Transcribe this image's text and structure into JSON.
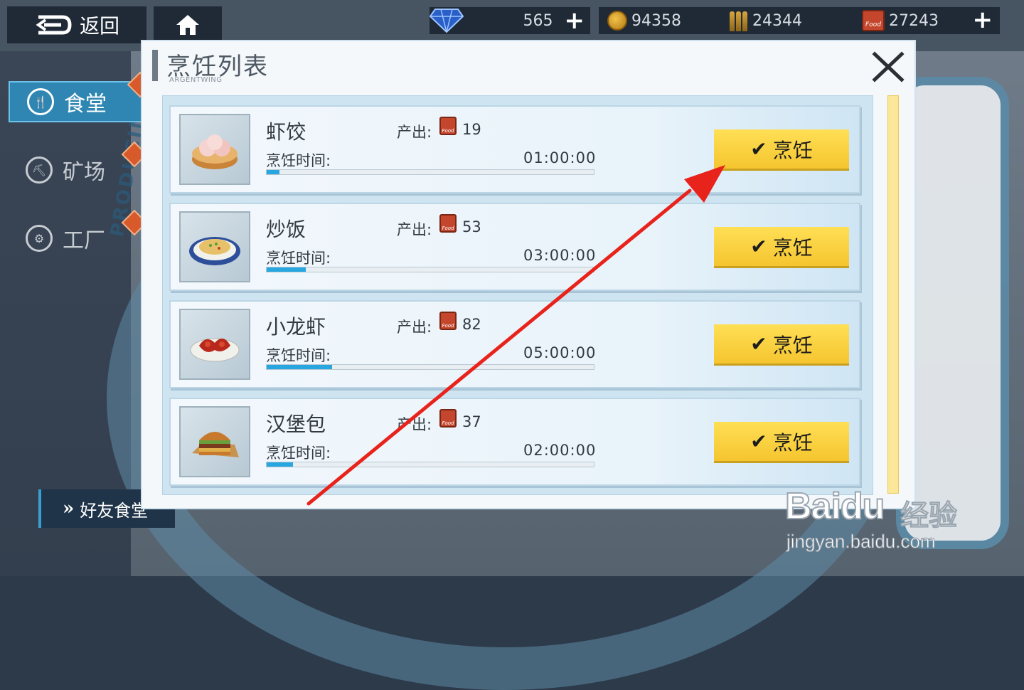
{
  "topbar": {
    "back_label": "返回",
    "diamonds": "565",
    "coins": "94358",
    "ammo": "24344",
    "food": "27243",
    "food_icon_text": "Food"
  },
  "sidebar": {
    "items": [
      {
        "label": "食堂",
        "icon": "cutlery-icon",
        "active": true
      },
      {
        "label": "矿场",
        "icon": "mine-icon",
        "active": false
      },
      {
        "label": "工厂",
        "icon": "factory-icon",
        "active": false
      }
    ],
    "friend_button": "好友食堂"
  },
  "background": {
    "ring_text": "PRODUCING"
  },
  "dialog": {
    "title": "烹饪列表",
    "subtitle": "ARGENTWING",
    "output_label": "产出:",
    "time_label": "烹饪时间:",
    "cook_label": "烹饪",
    "food_icon_text": "Food",
    "recipes": [
      {
        "name": "虾饺",
        "output": "19",
        "time": "01:00:00",
        "progress": 0.04,
        "image": "shrimp-dumpling"
      },
      {
        "name": "炒饭",
        "output": "53",
        "time": "03:00:00",
        "progress": 0.12,
        "image": "fried-rice"
      },
      {
        "name": "小龙虾",
        "output": "82",
        "time": "05:00:00",
        "progress": 0.2,
        "image": "crayfish"
      },
      {
        "name": "汉堡包",
        "output": "37",
        "time": "02:00:00",
        "progress": 0.08,
        "image": "hamburger"
      }
    ]
  },
  "colors": {
    "accent_blue": "#2f86b2",
    "cook_button": "#f5c52f",
    "progress": "#27a6df",
    "annotation_arrow": "#e8231b"
  },
  "watermark": {
    "logo": "Baidu",
    "cn": "经验",
    "url": "jingyan.baidu.com"
  }
}
